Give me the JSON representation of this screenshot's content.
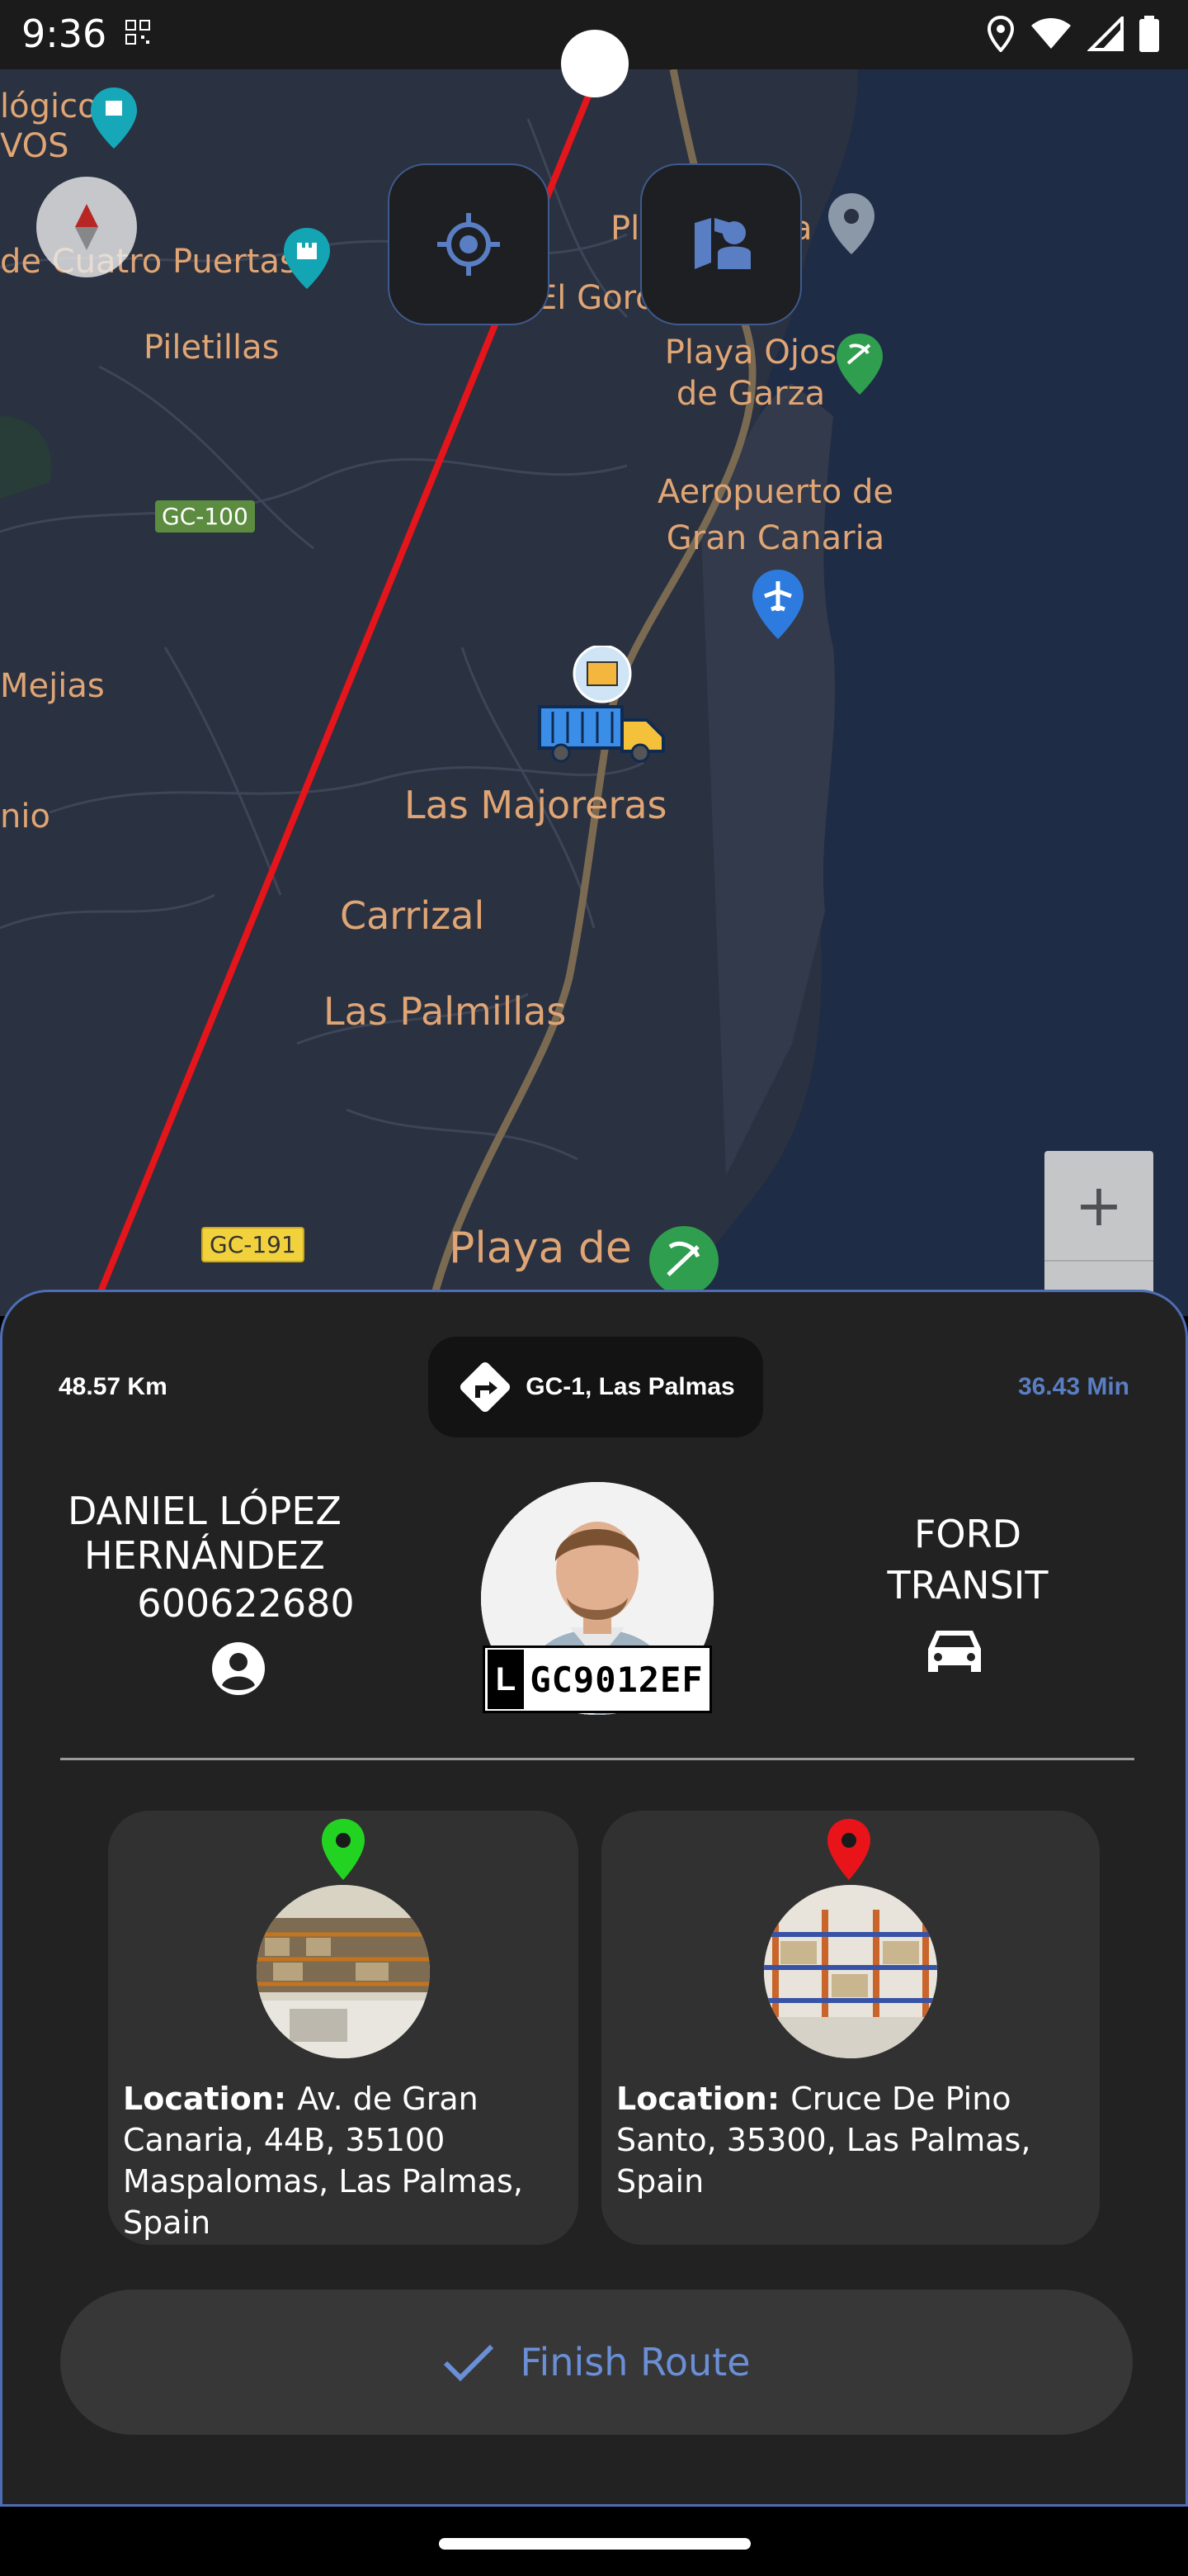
{
  "status_bar": {
    "time": "9:36"
  },
  "map": {
    "labels": [
      "lógico",
      "VOS",
      "de Cuatro Puertas",
      "Pl",
      "a",
      "El Goro",
      "Piletillas",
      "Playa Ojos de Garza",
      "Aeropuerto de Gran Canaria",
      "Mejias",
      "nio",
      "Las Majoreras",
      "Carrizal",
      "Las Palmillas",
      "Playa de"
    ],
    "road_badges": [
      "GC-100",
      "GC-191"
    ],
    "zoom_in": "+",
    "zoom_out": "−",
    "colors": {
      "route": "#e4151b",
      "highway": "#7a6a52",
      "sea": "#1f2c45",
      "land": "#2b3242"
    }
  },
  "route_info": {
    "distance": "48.57 Km",
    "street": "GC-1, Las Palmas",
    "duration": "36.43 Min"
  },
  "driver": {
    "name": "DANIEL LÓPEZ HERNÁNDEZ",
    "phone": "600622680",
    "plate_prefix": "L",
    "plate": "GC9012EF"
  },
  "vehicle": {
    "model": "FORD TRANSIT"
  },
  "locations": [
    {
      "label": "Location:",
      "address": "Av. de Gran Canaria, 44B, 35100 Maspalomas, Las Palmas, Spain",
      "pin_color": "#22d321"
    },
    {
      "label": "Location:",
      "address": "Cruce De Pino Santo, 35300, Las Palmas, Spain",
      "pin_color": "#e8141a"
    }
  ],
  "actions": {
    "finish_label": "Finish Route"
  }
}
